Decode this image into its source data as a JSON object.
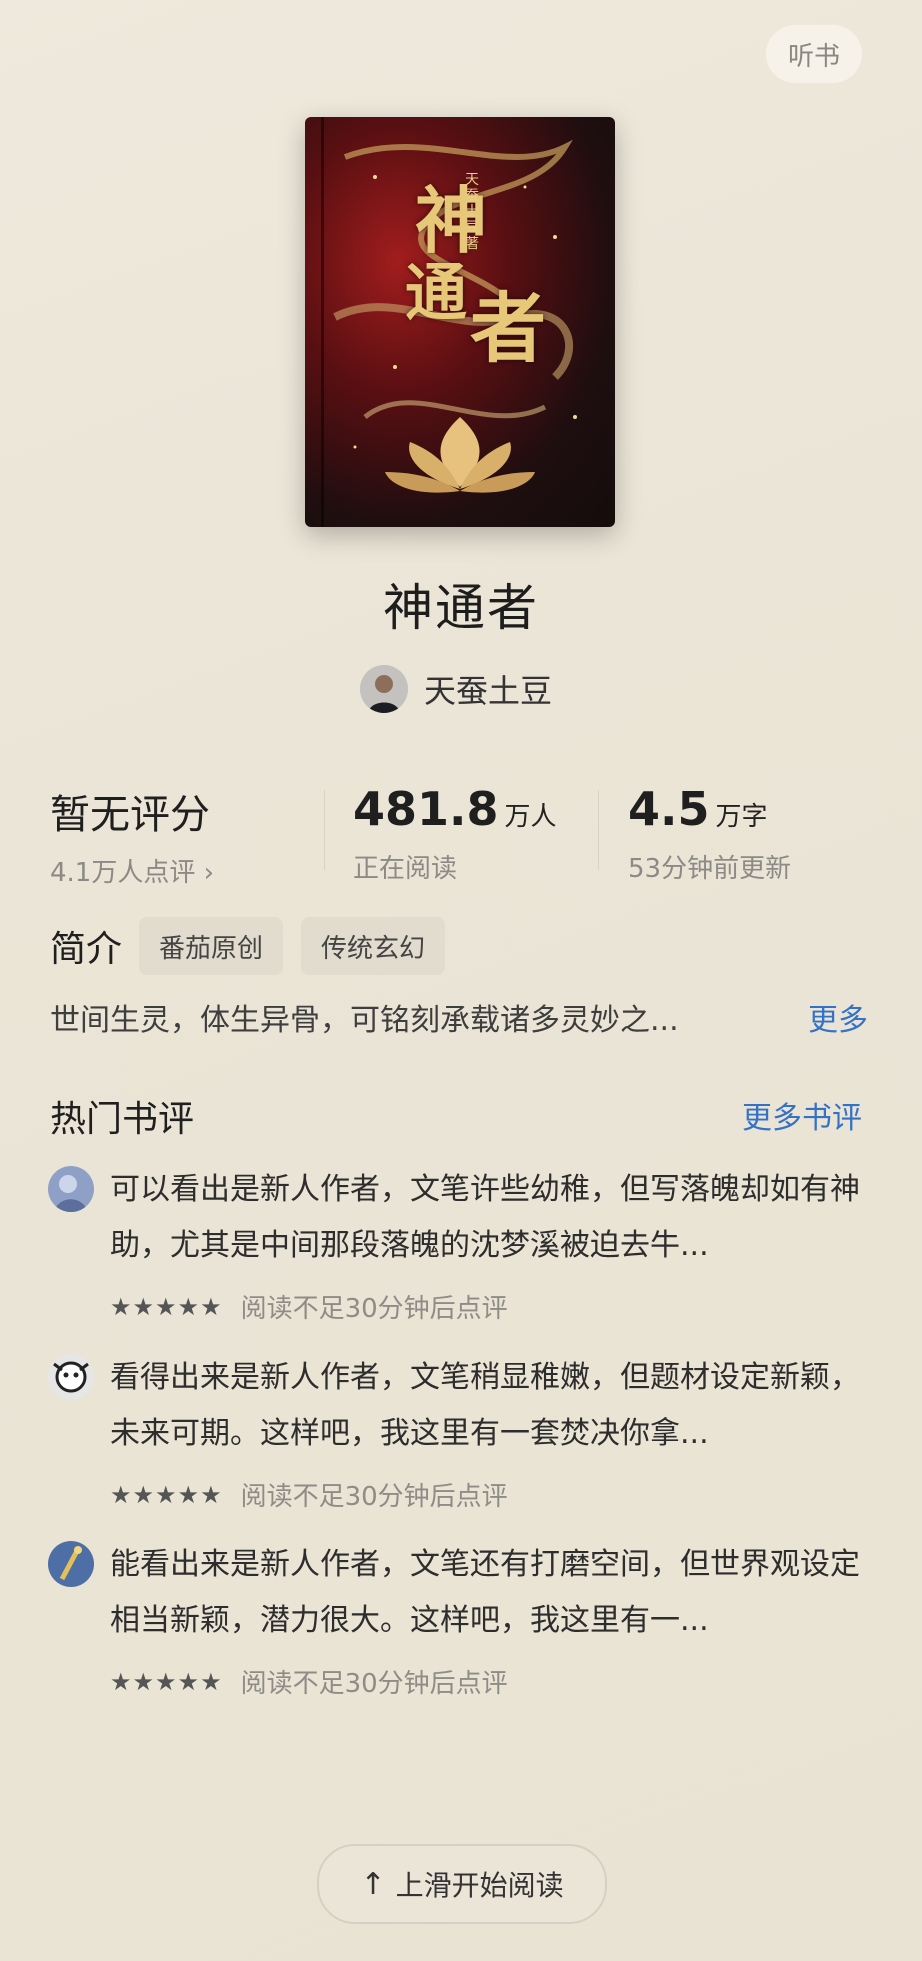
{
  "header": {
    "listen_label": "听书"
  },
  "cover": {
    "title_chars": [
      "神",
      "通",
      "者"
    ],
    "author_vertical": "天蚕土豆著"
  },
  "book": {
    "title": "神通者",
    "author": "天蚕土豆"
  },
  "stats": {
    "rating": {
      "main": "暂无评分",
      "sub": "4.1万人点评 ›"
    },
    "readers": {
      "value": "481.8",
      "unit": "万人",
      "sub": "正在阅读"
    },
    "words": {
      "value": "4.5",
      "unit": "万字",
      "sub": "53分钟前更新"
    }
  },
  "intro": {
    "label": "简介",
    "tags": [
      "番茄原创",
      "传统玄幻"
    ],
    "text": "世间生灵，体生异骨，可铭刻承载诸多灵妙之...",
    "more_label": "更多"
  },
  "hot_reviews": {
    "label": "热门书评",
    "more_label": "更多书评",
    "items": [
      {
        "text": "可以看出是新人作者，文笔许些幼稚，但写落魄却如有神助，尤其是中间那段落魄的沈梦溪被迫去牛...",
        "stars": "★★★★★",
        "note": "阅读不足30分钟后点评"
      },
      {
        "text": "看得出来是新人作者，文笔稍显稚嫩，但题材设定新颖，未来可期。这样吧，我这里有一套焚决你拿...",
        "stars": "★★★★★",
        "note": "阅读不足30分钟后点评"
      },
      {
        "text": "能看出来是新人作者，文笔还有打磨空间，但世界观设定相当新颖，潜力很大。这样吧，我这里有一...",
        "stars": "★★★★★",
        "note": "阅读不足30分钟后点评"
      }
    ]
  },
  "footer": {
    "start_reading_label": "上滑开始阅读",
    "arrow_icon": "arrow-up-icon"
  }
}
